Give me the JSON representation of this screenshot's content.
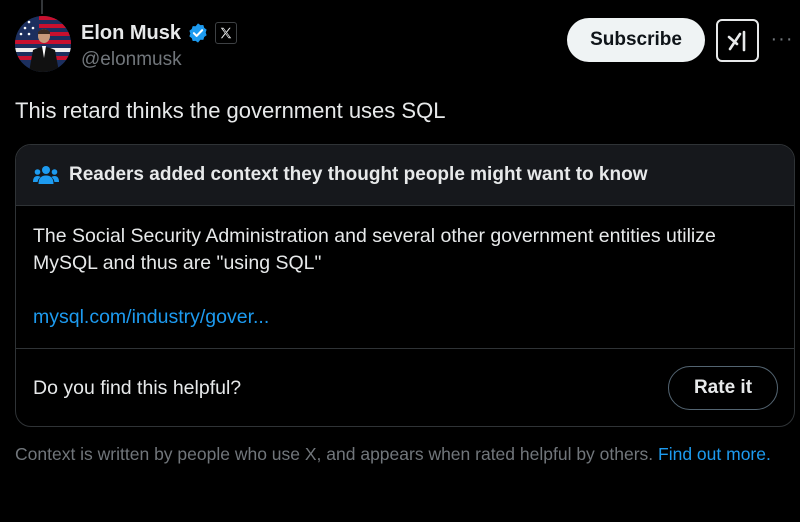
{
  "author": {
    "display_name": "Elon Musk",
    "handle": "@elonmusk",
    "verified_icon": "verified-badge-icon",
    "affiliation_icon": "x-logo-icon",
    "avatar": "avatar-photo-flag-background"
  },
  "actions": {
    "subscribe_label": "Subscribe",
    "grok_icon": "grok-icon",
    "more_icon": "more-horizontal-icon",
    "more_glyph": "···"
  },
  "tweet": {
    "text": "This retard thinks the government uses SQL"
  },
  "community_note": {
    "header_icon": "people-icon",
    "header_title": "Readers added context they thought people might want to know",
    "body_text": "The Social Security Administration and several other government entities utilize MySQL and thus are \"using SQL\"",
    "link_text": "mysql.com/industry/gover...",
    "helpful_question": "Do you find this helpful?",
    "rate_label": "Rate it"
  },
  "disclaimer": {
    "text": "Context is written by people who use X, and appears when rated helpful by others.",
    "link_text": "Find out more."
  },
  "colors": {
    "background": "#000000",
    "text_primary": "#e7e9ea",
    "text_secondary": "#71767b",
    "accent_blue": "#1d9bf0",
    "border": "#2f3336",
    "note_header_bg": "#16181c"
  }
}
